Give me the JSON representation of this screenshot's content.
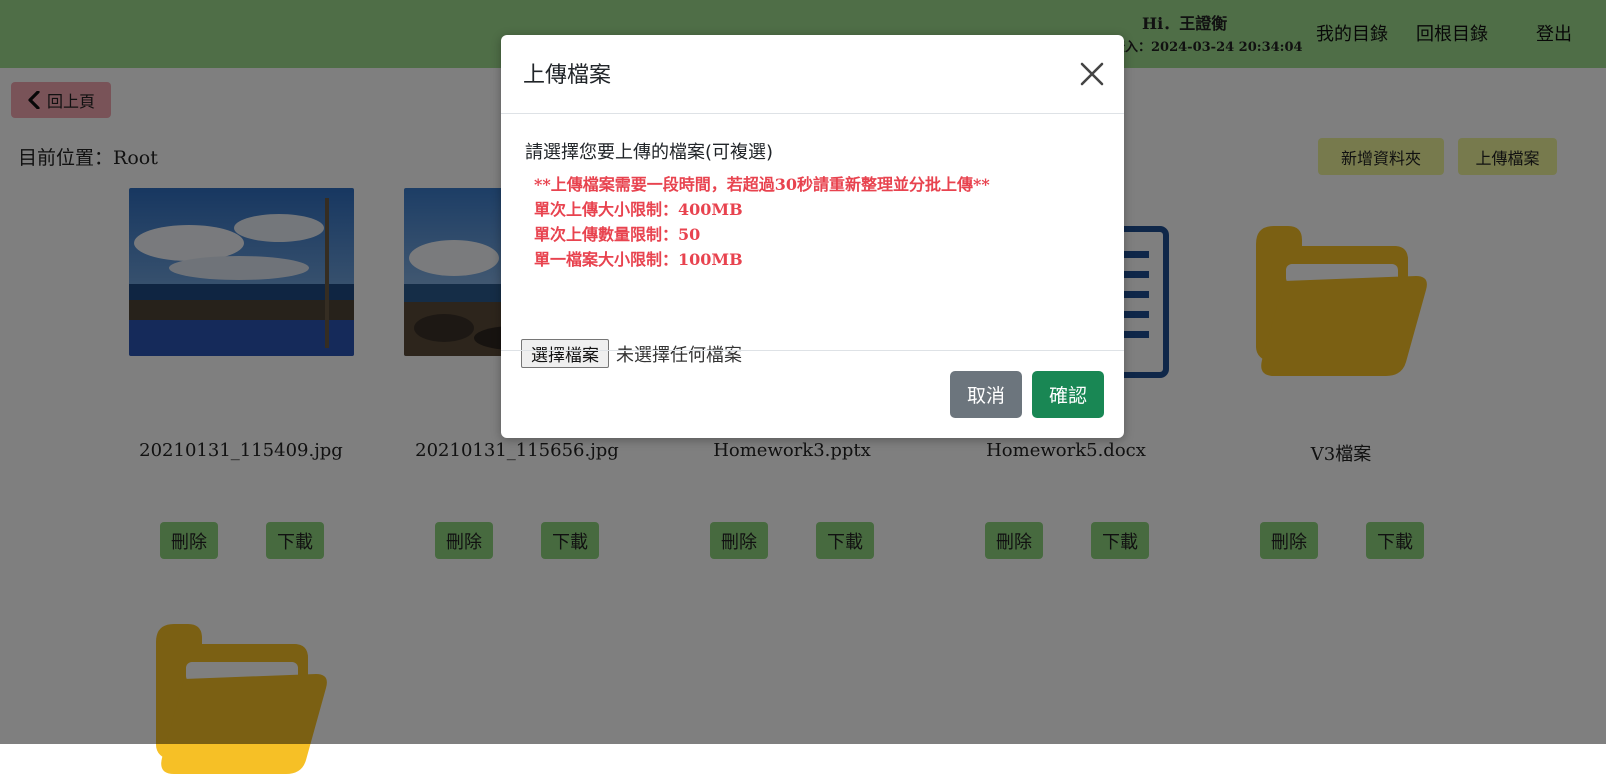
{
  "header": {
    "greeting": "Hi．王證衡",
    "last_login": "登入：2024-03-24 20:34:04",
    "nav": {
      "my_directory": "我的目錄",
      "root_directory": "回根目錄",
      "logout": "登出"
    },
    "bg_color": "#9fdc8f"
  },
  "toolbar": {
    "back_label": "回上頁",
    "location_label": "目前位置：",
    "location_value": "Root",
    "new_folder_label": "新增資料夾",
    "upload_label": "上傳檔案"
  },
  "files": [
    {
      "name": "20210131_115409.jpg",
      "type": "image",
      "delete_label": "刪除",
      "download_label": "下載"
    },
    {
      "name": "20210131_115656.jpg",
      "type": "image",
      "delete_label": "刪除",
      "download_label": "下載"
    },
    {
      "name": "Homework3.pptx",
      "type": "document",
      "delete_label": "刪除",
      "download_label": "下載"
    },
    {
      "name": "Homework5.docx",
      "type": "document",
      "delete_label": "刪除",
      "download_label": "下載"
    },
    {
      "name": "V3檔案",
      "type": "folder",
      "delete_label": "刪除",
      "download_label": "下載"
    },
    {
      "name": "",
      "type": "folder"
    }
  ],
  "modal": {
    "title": "上傳檔案",
    "prompt": "請選擇您要上傳的檔案(可複選)",
    "notes": [
      "**上傳檔案需要一段時間，若超過30秒請重新整理並分批上傳**",
      "單次上傳大小限制：400MB",
      "單次上傳數量限制：50",
      "單一檔案大小限制：100MB"
    ],
    "choose_file_label": "選擇檔案",
    "no_file_text": "未選擇任何檔案",
    "cancel_label": "取消",
    "confirm_label": "確認",
    "warning_color": "#e8434f",
    "confirm_color": "#198754",
    "cancel_color": "#6c757d"
  },
  "colors": {
    "folder": "#f6c026",
    "document": "#1f4f93",
    "action_button": "#8fd47e",
    "back_button": "#f3a6b0",
    "top_button": "#eef59a"
  }
}
